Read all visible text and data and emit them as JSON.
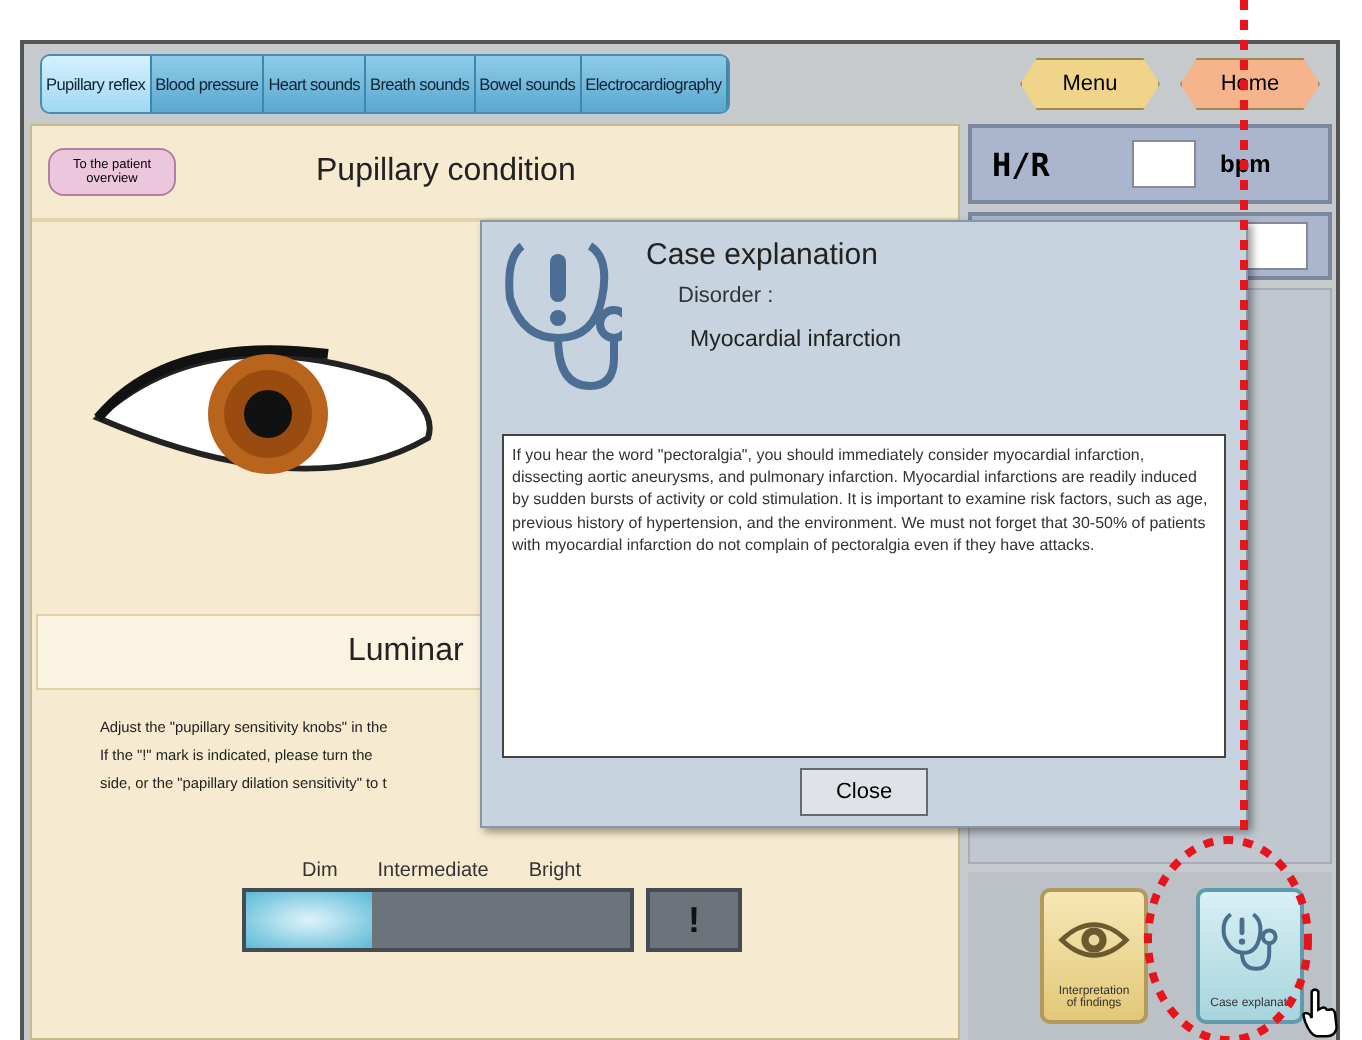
{
  "tabs": [
    {
      "label": "Pupillary reflex",
      "selected": true
    },
    {
      "label": "Blood pressure",
      "selected": false
    },
    {
      "label": "Heart sounds",
      "selected": false
    },
    {
      "label": "Breath sounds",
      "selected": false
    },
    {
      "label": "Bowel sounds",
      "selected": false
    },
    {
      "label": "Electrocardiography",
      "selected": false
    }
  ],
  "nav_buttons": [
    {
      "label": "Menu",
      "kind": "menu"
    },
    {
      "label": "Home",
      "kind": "home"
    }
  ],
  "patient_button": "To the patient overview",
  "panel_title": "Pupillary condition",
  "luminance_heading": "Luminar",
  "instructions": [
    "Adjust the \"pupillary sensitivity knobs\" in the",
    "If the \"!\" mark is indicated, please turn the",
    "side, or the \"papillary dilation sensitivity\" to t"
  ],
  "luminance": {
    "labels": [
      "Dim",
      "Intermediate",
      "Bright"
    ],
    "level": 0.33,
    "alert_button": "!"
  },
  "vitals": {
    "hr_label": "H/R",
    "hr_unit": "bpm"
  },
  "bottom_buttons": [
    {
      "label": "Interpretation of findings",
      "kind": "eye",
      "selected": false
    },
    {
      "label": "Case explanati",
      "kind": "stethoscope",
      "selected": true
    }
  ],
  "dialog": {
    "title": "Case explanation",
    "disorder_label": "Disorder :",
    "disorder": "Myocardial infarction",
    "text": "If you hear the word \"pectoralgia\", you should immediately consider myocardial infarction, dissecting aortic aneurysms, and pulmonary infarction.  Myocardial infarctions are readily induced by sudden bursts of activity or cold stimulation.  It is important to examine risk factors, such as age, previous history of hypertension, and the environment.  We must not forget that 30-50% of patients with myocardial infarction do not complain of pectoralgia even if they have attacks.",
    "close": "Close"
  }
}
